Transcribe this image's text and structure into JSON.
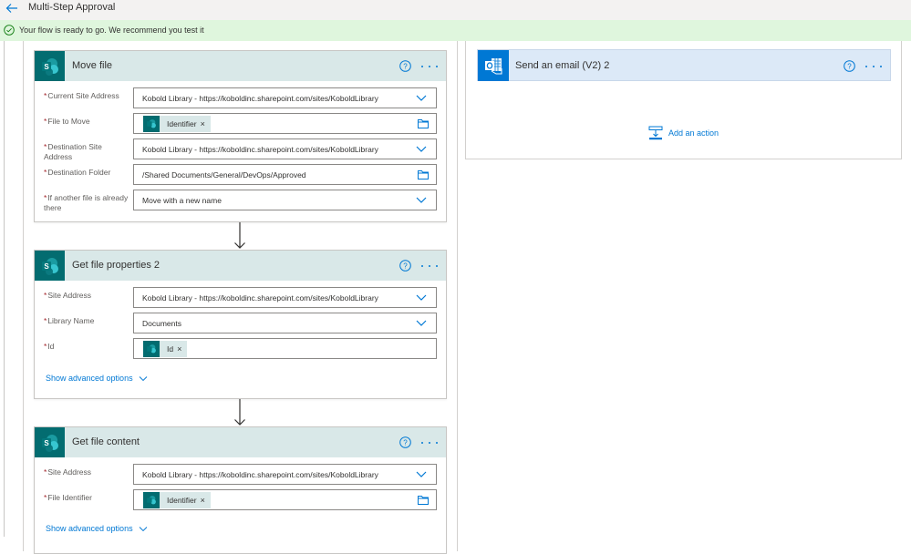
{
  "header": {
    "title": "Multi-Step Approval"
  },
  "banner": {
    "text": "Your flow is ready to go. We recommend you test it"
  },
  "colors": {
    "accent": "#0078d4",
    "sharepoint": "#036c70",
    "card_header": "#d9e8e8",
    "banner_bg": "#dff6dd",
    "required": "#a4262c"
  },
  "cards": {
    "move_file": {
      "title": "Move file",
      "fields": [
        {
          "label": "Current Site Address",
          "value": "Kobold Library - https://koboldinc.sharepoint.com/sites/KoboldLibrary",
          "type": "dropdown"
        },
        {
          "label": "File to Move",
          "token": "Identifier",
          "type": "file-picker"
        },
        {
          "label": "Destination Site Address",
          "value": "Kobold Library - https://koboldinc.sharepoint.com/sites/KoboldLibrary",
          "type": "dropdown"
        },
        {
          "label": "Destination Folder",
          "value": "/Shared Documents/General/DevOps/Approved",
          "type": "file-picker"
        },
        {
          "label": "If another file is already there",
          "value": "Move with a new name",
          "type": "dropdown"
        }
      ]
    },
    "get_file_properties": {
      "title": "Get file properties 2",
      "fields": [
        {
          "label": "Site Address",
          "value": "Kobold Library - https://koboldinc.sharepoint.com/sites/KoboldLibrary",
          "type": "dropdown"
        },
        {
          "label": "Library Name",
          "value": "Documents",
          "type": "dropdown"
        },
        {
          "label": "Id",
          "token": "Id",
          "type": "token"
        }
      ],
      "advanced_label": "Show advanced options"
    },
    "get_file_content": {
      "title": "Get file content",
      "fields": [
        {
          "label": "Site Address",
          "value": "Kobold Library - https://koboldinc.sharepoint.com/sites/KoboldLibrary",
          "type": "dropdown"
        },
        {
          "label": "File Identifier",
          "token": "Identifier",
          "type": "file-picker"
        }
      ],
      "advanced_label": "Show advanced options"
    },
    "send_email": {
      "title": "Send an email (V2) 2"
    }
  },
  "add_action": {
    "label": "Add an action"
  },
  "icons": {
    "back": "arrow-left",
    "banner": "check-circle",
    "help": "question-circle",
    "more": "ellipsis",
    "dropdown": "chevron-down",
    "folder": "folder",
    "sharepoint": "sharepoint-logo",
    "outlook": "outlook-logo",
    "add_action": "insert-step"
  }
}
